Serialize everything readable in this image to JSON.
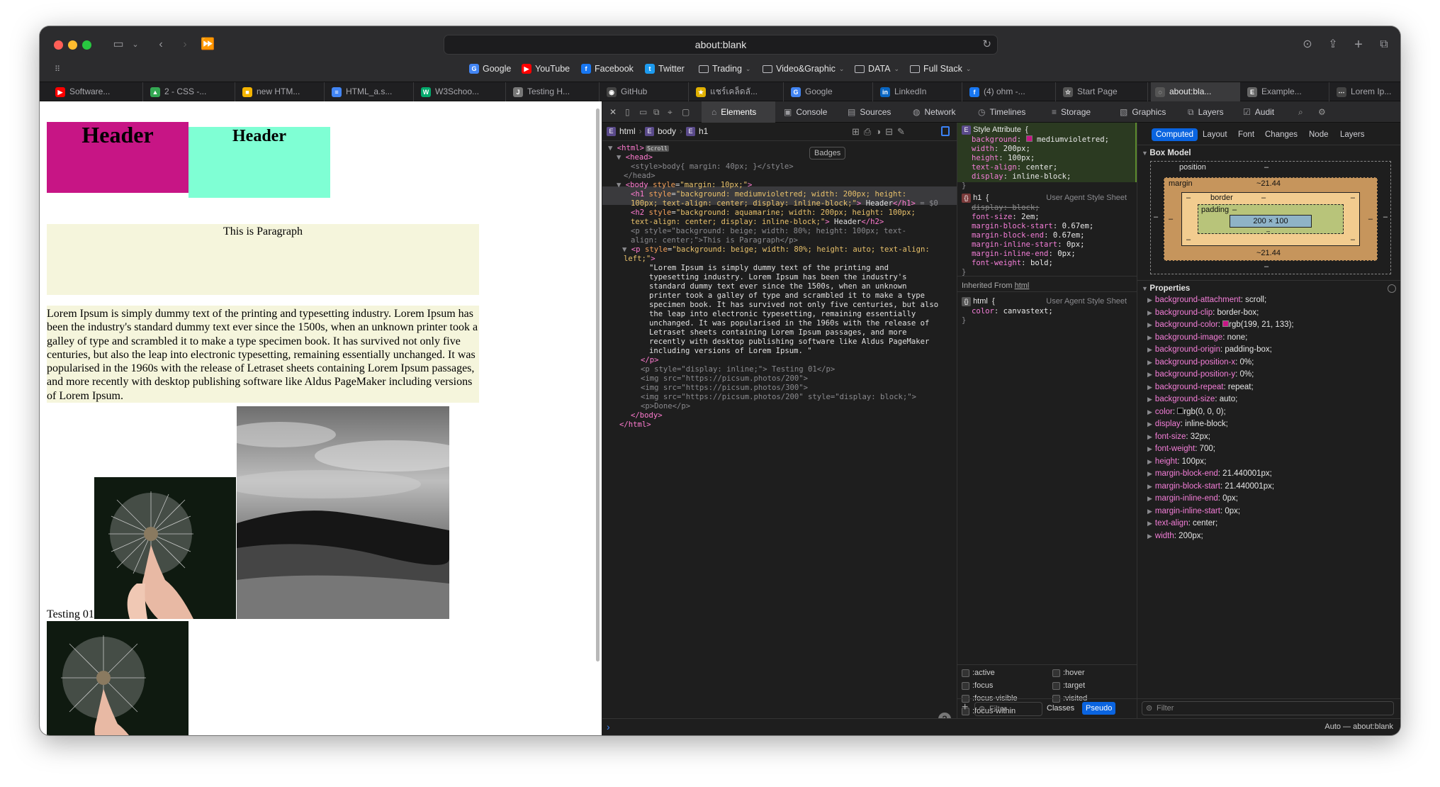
{
  "browser": {
    "address": "about:blank",
    "favorites": [
      {
        "label": "Google",
        "icon": "google-icon",
        "color": "#4285f4",
        "letter": "G"
      },
      {
        "label": "YouTube",
        "icon": "youtube-icon",
        "color": "#ff0000",
        "letter": "▶"
      },
      {
        "label": "Facebook",
        "icon": "facebook-icon",
        "color": "#1877f2",
        "letter": "f"
      },
      {
        "label": "Twitter",
        "icon": "twitter-icon",
        "color": "#1d9bf0",
        "letter": "t"
      },
      {
        "label": "Trading",
        "icon": "folder-icon",
        "menu": true
      },
      {
        "label": "Video&Graphic",
        "icon": "folder-icon",
        "menu": true
      },
      {
        "label": "DATA",
        "icon": "folder-icon",
        "menu": true
      },
      {
        "label": "Full Stack",
        "icon": "folder-icon",
        "menu": true
      }
    ],
    "tabs": [
      {
        "label": "Software...",
        "color": "#ff0000",
        "letter": "▶"
      },
      {
        "label": "2 - CSS -...",
        "color": "#34a853",
        "letter": "▲"
      },
      {
        "label": "new HTM...",
        "color": "#f4b400",
        "letter": "■"
      },
      {
        "label": "HTML_a.s...",
        "color": "#4285f4",
        "letter": "≡"
      },
      {
        "label": "W3Schoo...",
        "color": "#04aa6d",
        "letter": "W"
      },
      {
        "label": "Testing H...",
        "color": "#777777",
        "letter": "J"
      },
      {
        "label": "GitHub",
        "color": "#444444",
        "letter": "◉"
      },
      {
        "label": "แชร์เคล็ดลั...",
        "color": "#e0b000",
        "letter": "★"
      },
      {
        "label": "Google",
        "color": "#4285f4",
        "letter": "G"
      },
      {
        "label": "LinkedIn",
        "color": "#0a66c2",
        "letter": "in"
      },
      {
        "label": "(4) ohm -...",
        "color": "#1877f2",
        "letter": "f"
      },
      {
        "label": "Start Page",
        "color": "#555555",
        "letter": "☆"
      },
      {
        "label": "about:bla...",
        "color": "#555555",
        "letter": "◌",
        "active": true
      },
      {
        "label": "Example...",
        "color": "#666666",
        "letter": "E"
      },
      {
        "label": "Lorem Ip...",
        "color": "#444444",
        "letter": "⋯"
      }
    ]
  },
  "page": {
    "h1": "Header",
    "h2": "Header",
    "p1": "This is Paragraph",
    "p2": "Lorem Ipsum is simply dummy text of the printing and typesetting industry. Lorem Ipsum has been the industry's standard dummy text ever since the 1500s, when an unknown printer took a galley of type and scrambled it to make a type specimen book. It has survived not only five centuries, but also the leap into electronic typesetting, remaining essentially unchanged. It was popularised in the 1960s with the release of Letraset sheets containing Lorem Ipsum passages, and more recently with desktop publishing software like Aldus PageMaker including versions of Lorem Ipsum.",
    "testing": "Testing 01"
  },
  "devtools": {
    "tabs": [
      "Elements",
      "Console",
      "Sources",
      "Network",
      "Timelines",
      "Storage",
      "Graphics",
      "Layers",
      "Audit"
    ],
    "crumbs": [
      "html",
      "body",
      "h1"
    ],
    "badges": "Badges",
    "styles": {
      "style_attr_title": "Style Attribute  {",
      "style_attr": [
        {
          "k": "background",
          "v": "mediumvioletred;"
        },
        {
          "k": "width",
          "v": "200px;"
        },
        {
          "k": "height",
          "v": "100px;"
        },
        {
          "k": "text-align",
          "v": "center;"
        },
        {
          "k": "display",
          "v": "inline-block;"
        }
      ],
      "h1_selector": "h1  {",
      "ua_label": "User Agent Style Sheet",
      "h1_rules": [
        {
          "k": "display",
          "v": "block;",
          "struck": true
        },
        {
          "k": "font-size",
          "v": "2em;"
        },
        {
          "k": "margin-block-start",
          "v": "0.67em;"
        },
        {
          "k": "margin-block-end",
          "v": "0.67em;"
        },
        {
          "k": "margin-inline-start",
          "v": "0px;"
        },
        {
          "k": "margin-inline-end",
          "v": "0px;"
        },
        {
          "k": "font-weight",
          "v": "bold;"
        }
      ],
      "inherited": "Inherited From ",
      "inherited_link": "html",
      "html_selector": "html  {",
      "html_rules": [
        {
          "k": "color",
          "v": "canvastext;"
        }
      ],
      "pseudo": [
        ":active",
        ":hover",
        ":focus",
        ":target",
        ":focus-visible",
        ":visited",
        ":focus-within"
      ],
      "filter": "Filter",
      "classes": "Classes",
      "pseudo_btn": "Pseudo"
    },
    "computed": {
      "subtabs": [
        "Computed",
        "Layout",
        "Font",
        "Changes",
        "Node",
        "Layers"
      ],
      "box_model_title": "Box Model",
      "box": {
        "position": "position",
        "position_val": "–",
        "margin": "margin",
        "margin_top": "~21.44",
        "margin_bottom": "~21.44",
        "border": "border",
        "border_val": "–",
        "padding": "padding",
        "padding_val": "–",
        "content": "200 × 100",
        "dash": "–"
      },
      "properties_title": "Properties",
      "properties": [
        {
          "k": "background-attachment",
          "v": "scroll;"
        },
        {
          "k": "background-clip",
          "v": "border-box;"
        },
        {
          "k": "background-color",
          "v": "rgb(199, 21, 133);",
          "swatch": "#c71585"
        },
        {
          "k": "background-image",
          "v": "none;"
        },
        {
          "k": "background-origin",
          "v": "padding-box;"
        },
        {
          "k": "background-position-x",
          "v": "0%;"
        },
        {
          "k": "background-position-y",
          "v": "0%;"
        },
        {
          "k": "background-repeat",
          "v": "repeat;"
        },
        {
          "k": "background-size",
          "v": "auto;"
        },
        {
          "k": "color",
          "v": "rgb(0, 0, 0);",
          "swatch": "#000000"
        },
        {
          "k": "display",
          "v": "inline-block;"
        },
        {
          "k": "font-size",
          "v": "32px;"
        },
        {
          "k": "font-weight",
          "v": "700;"
        },
        {
          "k": "height",
          "v": "100px;"
        },
        {
          "k": "margin-block-end",
          "v": "21.440001px;"
        },
        {
          "k": "margin-block-start",
          "v": "21.440001px;"
        },
        {
          "k": "margin-inline-end",
          "v": "0px;"
        },
        {
          "k": "margin-inline-start",
          "v": "0px;"
        },
        {
          "k": "text-align",
          "v": "center;"
        },
        {
          "k": "width",
          "v": "200px;"
        }
      ],
      "filter": "Filter"
    },
    "console_context": "Auto — about:blank"
  }
}
